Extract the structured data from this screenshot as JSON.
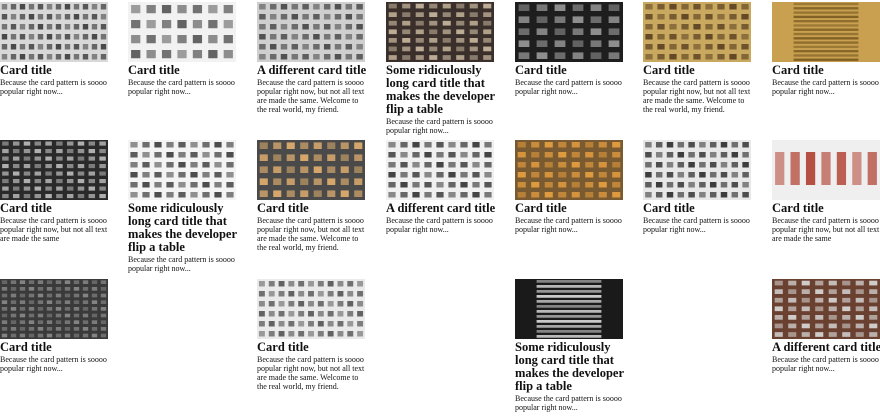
{
  "cards": [
    {
      "title": "Card title",
      "text": "Because the card pattern is soooo popular right now...",
      "image": "office-facade-grid-photo"
    },
    {
      "title": "Card title",
      "text": "Because the card pattern is soooo popular right now...",
      "image": "white-building-columns-photo"
    },
    {
      "title": "A different card title",
      "text": "Because the card pattern is soooo popular right now, but not all text are made the same. Welcome to the real world, my friend.",
      "image": "concrete-tower-windows-photo"
    },
    {
      "title": "Some ridiculously long card title that makes the developer flip a table",
      "text": "Because the card pattern is soooo popular right now...",
      "image": "dark-brick-building-photo"
    },
    {
      "title": "Card title",
      "text": "Because the card pattern is soooo popular right now...",
      "image": "black-glass-building-photo"
    },
    {
      "title": "Card title",
      "text": "Because the card pattern is soooo popular right now, but not all text are made the same. Welcome to the real world, my friend.",
      "image": "yellow-apartment-block-photo"
    },
    {
      "title": "Card title",
      "text": "Because the card pattern is soooo popular right now...",
      "image": "golden-striped-facade-photo"
    },
    {
      "title": "Card title",
      "text": "Because the card pattern is soooo popular right now, but not all text are made the same",
      "image": "glass-skyscraper-diagonal-photo"
    },
    {
      "title": "Some ridiculously long card title that makes the developer flip a table",
      "text": "Because the card pattern is soooo popular right now...",
      "image": "angled-white-balconies-photo"
    },
    {
      "title": "Card title",
      "text": "Because the card pattern is soooo popular right now, but not all text are made the same. Welcome to the real world, my friend.",
      "image": "lit-windows-night-photo"
    },
    {
      "title": "A different card title",
      "text": "Because the card pattern is soooo popular right now...",
      "image": "white-apartment-rows-photo"
    },
    {
      "title": "Card title",
      "text": "Because the card pattern is soooo popular right now...",
      "image": "orange-balconies-photo"
    },
    {
      "title": "Card title",
      "text": "Because the card pattern is soooo popular right now...",
      "image": "grey-tenement-windows-photo"
    },
    {
      "title": "Card title",
      "text": "Because the card pattern is soooo popular right now, but not all text are made the same",
      "image": "red-striped-building-photo"
    },
    {
      "title": "Card title",
      "text": "Because the card pattern is soooo popular right now...",
      "image": "dark-highrise-photo"
    },
    {
      "title": "Card title",
      "text": "Because the card pattern is soooo popular right now, but not all text are made the same. Welcome to the real world, my friend.",
      "image": "colorful-windows-grid-photo"
    },
    {
      "title": "Some ridiculously long card title that makes the developer flip a table",
      "text": "Because the card pattern is soooo popular right now...",
      "image": "black-white-striped-facade-photo"
    },
    {
      "title": "A different card title",
      "text": "Because the card pattern is soooo popular right now...",
      "image": "brick-building-with-tree-photo"
    }
  ]
}
